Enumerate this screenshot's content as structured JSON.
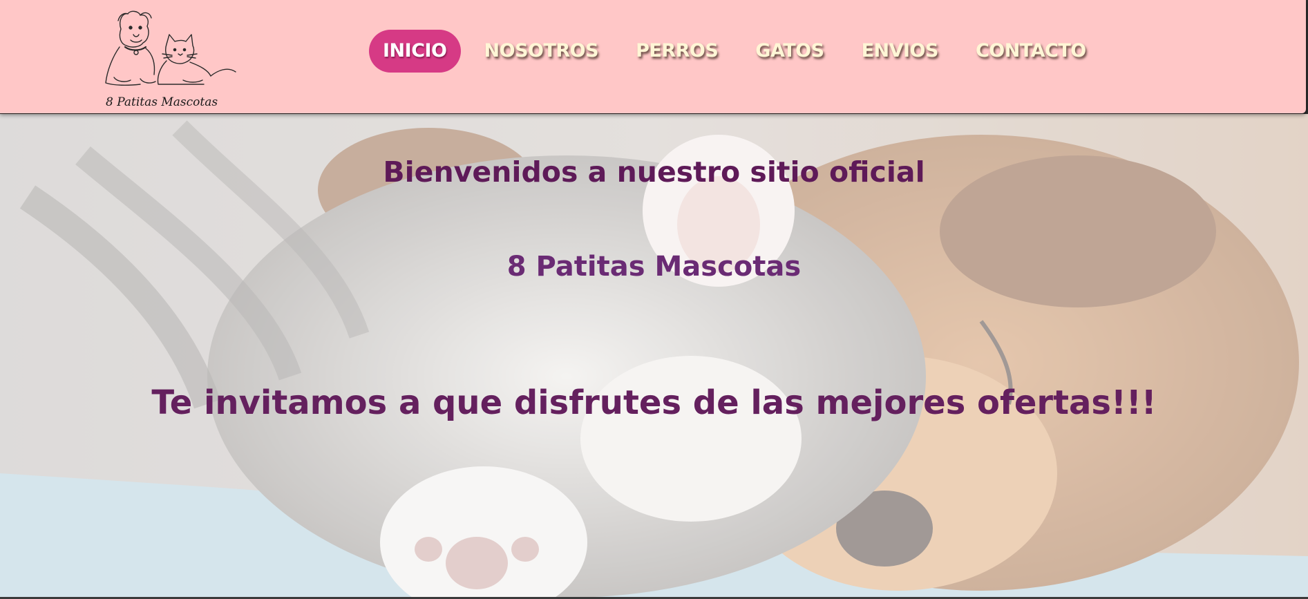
{
  "site": {
    "logo_text": "8 Patitas Mascotas",
    "logo_icon": "dog-and-cat-icon"
  },
  "nav": {
    "items": [
      {
        "label": "INICIO",
        "active": true
      },
      {
        "label": "NOSOTROS",
        "active": false
      },
      {
        "label": "PERROS",
        "active": false
      },
      {
        "label": "GATOS",
        "active": false
      },
      {
        "label": "ENVIOS",
        "active": false
      },
      {
        "label": "CONTACTO",
        "active": false
      }
    ]
  },
  "hero": {
    "welcome": "Bienvenidos a nuestro sitio oficial",
    "brand": "8 Patitas Mascotas",
    "invite": "Te invitamos a que disfrutes de las mejores ofertas!!!",
    "image": "kitten-and-puppy-sleeping-photo"
  },
  "colors": {
    "header_bg": "#ffc7c7",
    "nav_active_bg": "#d63a85",
    "nav_text": "#fff6d6",
    "heading_text": "#5e1a58"
  }
}
